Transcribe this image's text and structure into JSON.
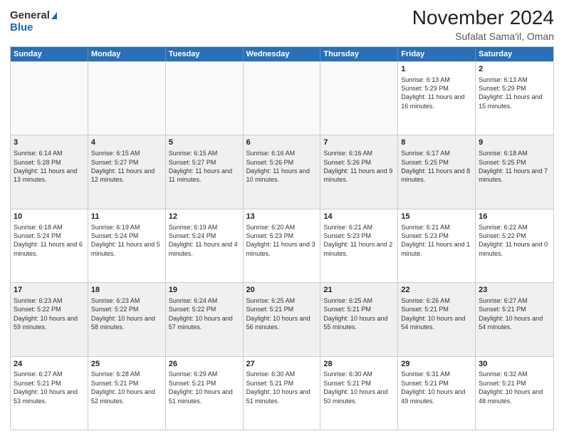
{
  "header": {
    "logo_general": "General",
    "logo_blue": "Blue",
    "month": "November 2024",
    "location": "Sufalat Sama'il, Oman"
  },
  "calendar": {
    "days": [
      "Sunday",
      "Monday",
      "Tuesday",
      "Wednesday",
      "Thursday",
      "Friday",
      "Saturday"
    ],
    "rows": [
      [
        {
          "day": "",
          "text": ""
        },
        {
          "day": "",
          "text": ""
        },
        {
          "day": "",
          "text": ""
        },
        {
          "day": "",
          "text": ""
        },
        {
          "day": "",
          "text": ""
        },
        {
          "day": "1",
          "text": "Sunrise: 6:13 AM\nSunset: 5:29 PM\nDaylight: 11 hours and 16 minutes."
        },
        {
          "day": "2",
          "text": "Sunrise: 6:13 AM\nSunset: 5:29 PM\nDaylight: 11 hours and 15 minutes."
        }
      ],
      [
        {
          "day": "3",
          "text": "Sunrise: 6:14 AM\nSunset: 5:28 PM\nDaylight: 11 hours and 13 minutes."
        },
        {
          "day": "4",
          "text": "Sunrise: 6:15 AM\nSunset: 5:27 PM\nDaylight: 11 hours and 12 minutes."
        },
        {
          "day": "5",
          "text": "Sunrise: 6:15 AM\nSunset: 5:27 PM\nDaylight: 11 hours and 11 minutes."
        },
        {
          "day": "6",
          "text": "Sunrise: 6:16 AM\nSunset: 5:26 PM\nDaylight: 11 hours and 10 minutes."
        },
        {
          "day": "7",
          "text": "Sunrise: 6:16 AM\nSunset: 5:26 PM\nDaylight: 11 hours and 9 minutes."
        },
        {
          "day": "8",
          "text": "Sunrise: 6:17 AM\nSunset: 5:25 PM\nDaylight: 11 hours and 8 minutes."
        },
        {
          "day": "9",
          "text": "Sunrise: 6:18 AM\nSunset: 5:25 PM\nDaylight: 11 hours and 7 minutes."
        }
      ],
      [
        {
          "day": "10",
          "text": "Sunrise: 6:18 AM\nSunset: 5:24 PM\nDaylight: 11 hours and 6 minutes."
        },
        {
          "day": "11",
          "text": "Sunrise: 6:19 AM\nSunset: 5:24 PM\nDaylight: 11 hours and 5 minutes."
        },
        {
          "day": "12",
          "text": "Sunrise: 6:19 AM\nSunset: 5:24 PM\nDaylight: 11 hours and 4 minutes."
        },
        {
          "day": "13",
          "text": "Sunrise: 6:20 AM\nSunset: 5:23 PM\nDaylight: 11 hours and 3 minutes."
        },
        {
          "day": "14",
          "text": "Sunrise: 6:21 AM\nSunset: 5:23 PM\nDaylight: 11 hours and 2 minutes."
        },
        {
          "day": "15",
          "text": "Sunrise: 6:21 AM\nSunset: 5:23 PM\nDaylight: 11 hours and 1 minute."
        },
        {
          "day": "16",
          "text": "Sunrise: 6:22 AM\nSunset: 5:22 PM\nDaylight: 11 hours and 0 minutes."
        }
      ],
      [
        {
          "day": "17",
          "text": "Sunrise: 6:23 AM\nSunset: 5:22 PM\nDaylight: 10 hours and 59 minutes."
        },
        {
          "day": "18",
          "text": "Sunrise: 6:23 AM\nSunset: 5:22 PM\nDaylight: 10 hours and 58 minutes."
        },
        {
          "day": "19",
          "text": "Sunrise: 6:24 AM\nSunset: 5:22 PM\nDaylight: 10 hours and 57 minutes."
        },
        {
          "day": "20",
          "text": "Sunrise: 6:25 AM\nSunset: 5:21 PM\nDaylight: 10 hours and 56 minutes."
        },
        {
          "day": "21",
          "text": "Sunrise: 6:25 AM\nSunset: 5:21 PM\nDaylight: 10 hours and 55 minutes."
        },
        {
          "day": "22",
          "text": "Sunrise: 6:26 AM\nSunset: 5:21 PM\nDaylight: 10 hours and 54 minutes."
        },
        {
          "day": "23",
          "text": "Sunrise: 6:27 AM\nSunset: 5:21 PM\nDaylight: 10 hours and 54 minutes."
        }
      ],
      [
        {
          "day": "24",
          "text": "Sunrise: 6:27 AM\nSunset: 5:21 PM\nDaylight: 10 hours and 53 minutes."
        },
        {
          "day": "25",
          "text": "Sunrise: 6:28 AM\nSunset: 5:21 PM\nDaylight: 10 hours and 52 minutes."
        },
        {
          "day": "26",
          "text": "Sunrise: 6:29 AM\nSunset: 5:21 PM\nDaylight: 10 hours and 51 minutes."
        },
        {
          "day": "27",
          "text": "Sunrise: 6:30 AM\nSunset: 5:21 PM\nDaylight: 10 hours and 51 minutes."
        },
        {
          "day": "28",
          "text": "Sunrise: 6:30 AM\nSunset: 5:21 PM\nDaylight: 10 hours and 50 minutes."
        },
        {
          "day": "29",
          "text": "Sunrise: 6:31 AM\nSunset: 5:21 PM\nDaylight: 10 hours and 49 minutes."
        },
        {
          "day": "30",
          "text": "Sunrise: 6:32 AM\nSunset: 5:21 PM\nDaylight: 10 hours and 48 minutes."
        }
      ]
    ]
  }
}
